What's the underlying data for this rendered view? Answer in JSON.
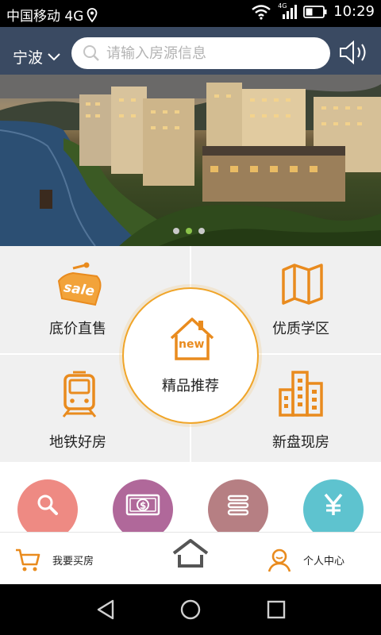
{
  "status_bar": {
    "carrier": "中国移动 4G",
    "network_badge": "4G",
    "time": "10:29"
  },
  "header": {
    "city": "宁波",
    "search_placeholder": "请输入房源信息"
  },
  "banner": {
    "page_count": 3,
    "active_index": 1
  },
  "grid": {
    "items": [
      {
        "label": "底价直售",
        "icon": "sale-tag-icon"
      },
      {
        "label": "优质学区",
        "icon": "map-icon"
      },
      {
        "label": "地铁好房",
        "icon": "metro-train-icon"
      },
      {
        "label": "新盘现房",
        "icon": "buildings-icon"
      }
    ],
    "center": {
      "label": "精品推荐",
      "icon": "new-house-icon"
    }
  },
  "round_buttons": [
    {
      "icon": "search-icon",
      "color": "#ee8a83"
    },
    {
      "icon": "money-icon",
      "color": "#b0689a"
    },
    {
      "icon": "list-icon",
      "color": "#b67f83"
    },
    {
      "icon": "yuan-icon",
      "color": "#5ec3cf"
    }
  ],
  "tabbar": {
    "buy": "我要买房",
    "personal": "个人中心"
  },
  "colors": {
    "accent": "#f0a529",
    "accent_dark": "#e98b1e"
  }
}
